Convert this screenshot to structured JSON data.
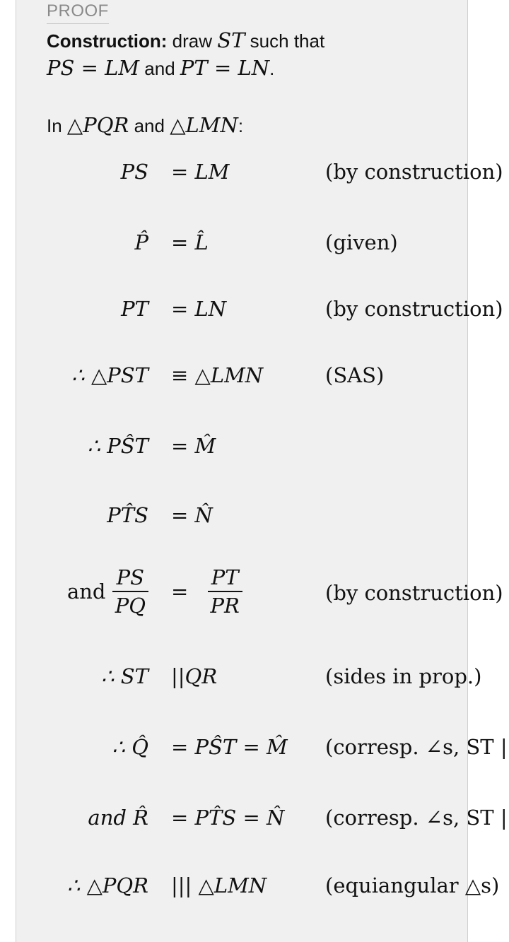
{
  "heading": "PROOF",
  "construction": {
    "label": "Construction:",
    "text1": " draw ",
    "math1": "ST",
    "text2": " such that",
    "math2": "PS = LM",
    "text3": " and ",
    "math3": "PT = LN",
    "text4": "."
  },
  "intro": {
    "text1": "In ",
    "math1": "△PQR",
    "text2": " and ",
    "math2": "△LMN",
    "text3": ":"
  },
  "proof_rows": [
    {
      "lhs": "PS",
      "rel": "= LM",
      "reason": "(by construction)"
    },
    {
      "lhs": "P̂",
      "rel": "= L̂",
      "reason": "(given)"
    },
    {
      "lhs": "PT",
      "rel": "= LN",
      "reason": "(by construction)"
    },
    {
      "lhs": "∴ △PST",
      "rel": "≡ △LMN",
      "reason": "(SAS)"
    },
    {
      "lhs": "∴ PŜT",
      "rel": "= M̂",
      "reason": ""
    },
    {
      "lhs": "PT̂S",
      "rel": "= N̂",
      "reason": ""
    },
    {
      "lhs_prefix": "and",
      "lhs_num": "PS",
      "lhs_den": "PQ",
      "rel_sign": "=",
      "rel_num": "PT",
      "rel_den": "PR",
      "reason": "(by construction)"
    },
    {
      "lhs": "∴ ST",
      "rel": "||QR",
      "reason": "(sides in prop.)"
    },
    {
      "lhs": "∴ Q̂",
      "rel": "= PŜT = M̂",
      "reason": "(corresp. ∠s, ST ||"
    },
    {
      "lhs": "and R̂",
      "rel": "= PT̂S = N̂",
      "reason": "(corresp. ∠s, ST ||"
    },
    {
      "lhs": "∴ △PQR",
      "rel": "||| △LMN",
      "reason": "(equiangular △s)"
    }
  ]
}
